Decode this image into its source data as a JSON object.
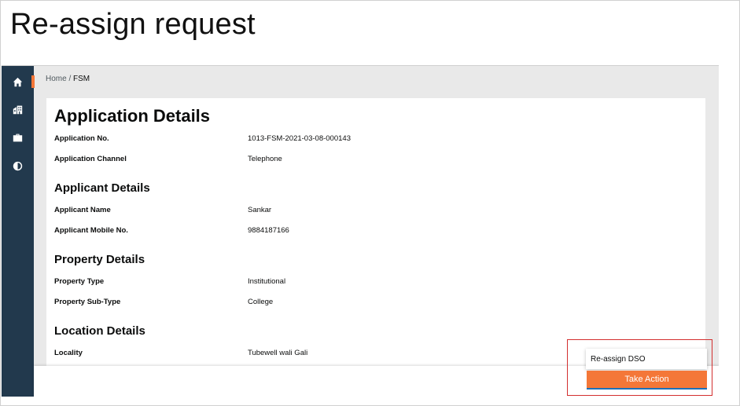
{
  "slide": {
    "title": "Re-assign request"
  },
  "sidebar": {
    "icons": [
      "home-icon",
      "building-icon",
      "briefcase-icon",
      "contrast-icon"
    ],
    "accent_color": "#f47738",
    "background_color": "#22394d"
  },
  "breadcrumb": {
    "home": "Home",
    "separator": " / ",
    "current": "FSM"
  },
  "application_details": {
    "title": "Application Details",
    "rows": [
      {
        "label": "Application No.",
        "value": "1013-FSM-2021-03-08-000143"
      },
      {
        "label": "Application Channel",
        "value": "Telephone"
      }
    ]
  },
  "applicant_details": {
    "title": "Applicant Details",
    "rows": [
      {
        "label": "Applicant Name",
        "value": "Sankar"
      },
      {
        "label": "Applicant Mobile No.",
        "value": "9884187166"
      }
    ]
  },
  "property_details": {
    "title": "Property Details",
    "rows": [
      {
        "label": "Property Type",
        "value": "Institutional"
      },
      {
        "label": "Property Sub-Type",
        "value": "College"
      }
    ]
  },
  "location_details": {
    "title": "Location Details",
    "rows": [
      {
        "label": "Locality",
        "value": "Tubewell wali Gali"
      }
    ]
  },
  "action_menu": {
    "items": [
      "Re-assign DSO"
    ],
    "button_label": "Take Action",
    "button_color": "#f47738",
    "highlight_color": "#d32f2f"
  }
}
